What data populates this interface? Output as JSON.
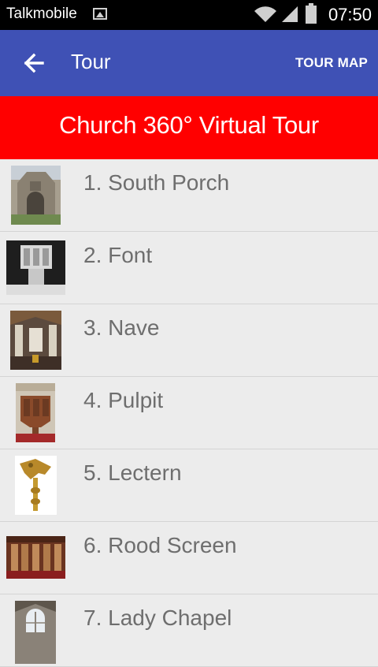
{
  "status_bar": {
    "carrier": "Talkmobile",
    "time": "07:50"
  },
  "app_bar": {
    "title": "Tour",
    "action": "TOUR MAP"
  },
  "banner": {
    "text": "Church 360° Virtual Tour"
  },
  "tour_items": [
    {
      "label": "1. South Porch",
      "thumbnail": "south-porch-photo"
    },
    {
      "label": "2. Font",
      "thumbnail": "font-photo"
    },
    {
      "label": "3. Nave",
      "thumbnail": "nave-photo"
    },
    {
      "label": "4. Pulpit",
      "thumbnail": "pulpit-photo"
    },
    {
      "label": "5. Lectern",
      "thumbnail": "lectern-photo"
    },
    {
      "label": "6. Rood Screen",
      "thumbnail": "rood-screen-photo"
    },
    {
      "label": "7. Lady Chapel",
      "thumbnail": "lady-chapel-photo"
    }
  ],
  "colors": {
    "app_bar": "#3f51b5",
    "banner": "#ff0000",
    "list_bg": "#ececec",
    "label_text": "#6e6e6e"
  }
}
